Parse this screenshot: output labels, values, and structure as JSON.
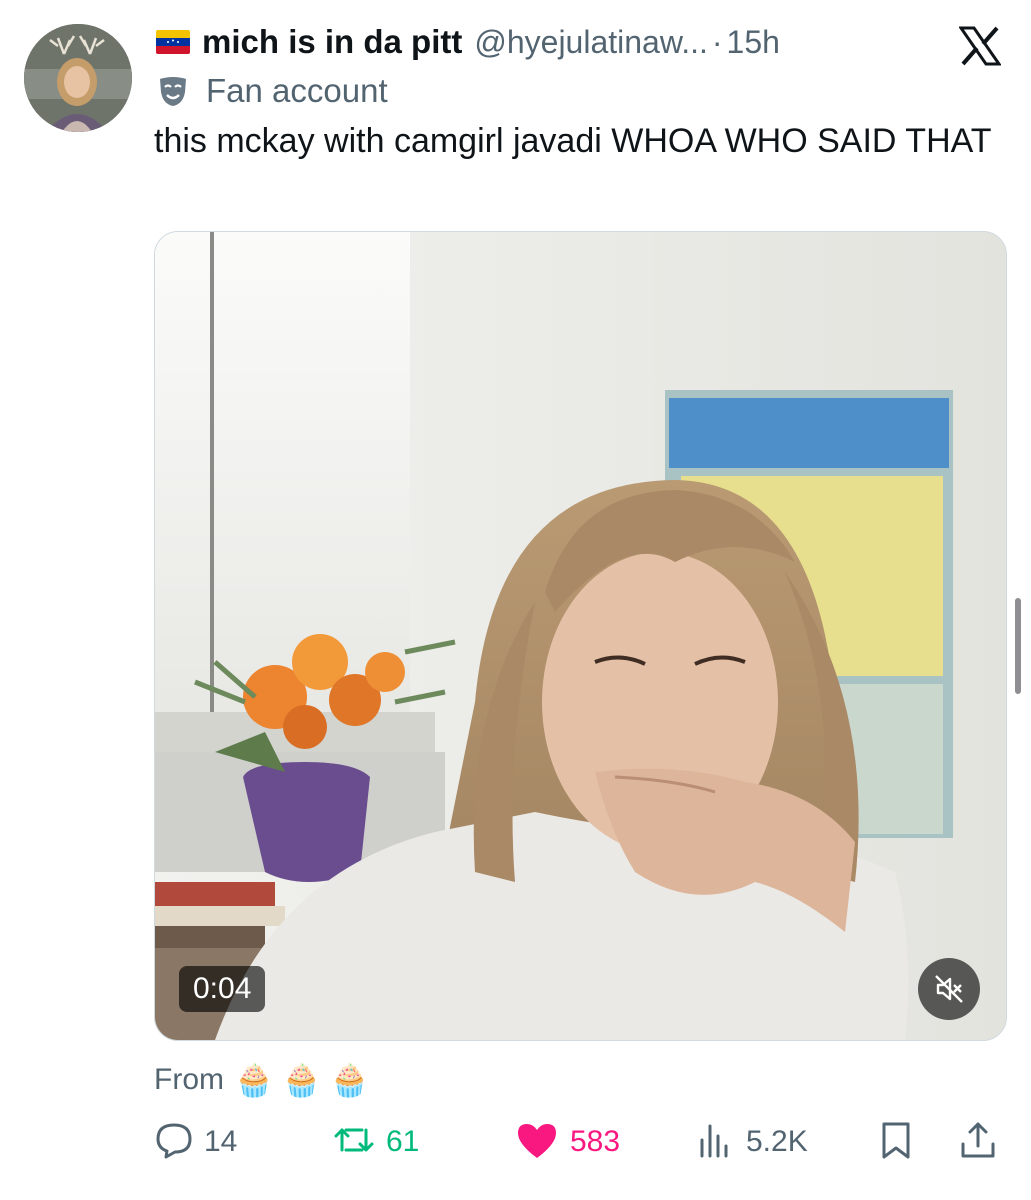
{
  "author": {
    "display_name": "mich is in da pitt",
    "handle": "@hyejulatinaw...",
    "separator": "·",
    "timestamp": "15h",
    "label": "Fan account",
    "flag_icon": "venezuela-flag-icon",
    "label_icon": "theater-masks-icon"
  },
  "tweet": {
    "text": "this mckay with camgirl javadi WHOA WHO SAID THAT"
  },
  "media": {
    "type": "video",
    "duration": "0:04",
    "muted": true
  },
  "from": {
    "label": "From",
    "emojis": [
      "🧁",
      "🧁",
      "🧁"
    ]
  },
  "actions": {
    "replies": "14",
    "reposts": "61",
    "likes": "583",
    "views": "5.2K"
  },
  "colors": {
    "text_primary": "#0f1419",
    "text_secondary": "#536471",
    "repost_green": "#00ba7c",
    "like_pink": "#f91880"
  }
}
